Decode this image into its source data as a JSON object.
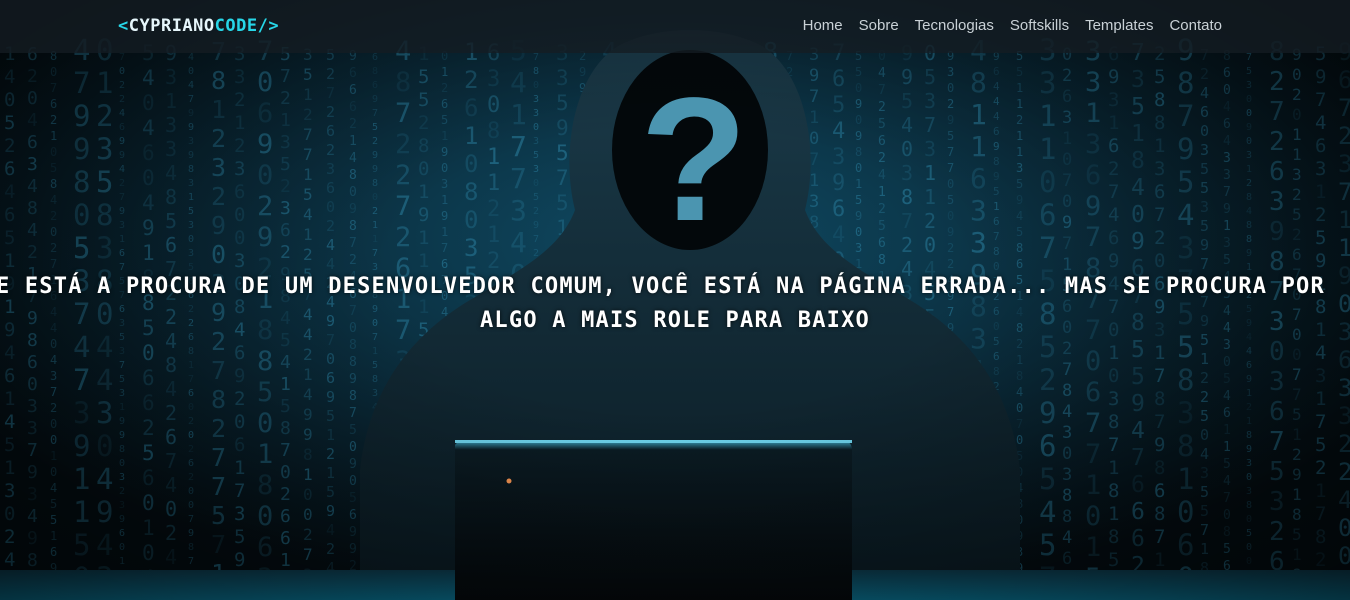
{
  "navbar": {
    "logo": {
      "open_bracket": "<",
      "part1": "CYPRIANO",
      "part2": "CODE",
      "close_bracket": "/>"
    },
    "links": [
      "Home",
      "Sobre",
      "Tecnologias",
      "Softskills",
      "Templates",
      "Contato"
    ]
  },
  "hero": {
    "question_mark": "?",
    "headline_line1": "S E ESTÁ A PROCURA DE UM DESENVOLVEDOR COMUM, VOCÊ ESTÁ NA PÁGINA ERRADA... MAS SE PROCURA POR",
    "headline_line2": "ALGO A MAIS ROLE PARA BAIXO",
    "background": "hooded-hacker-with-laptop-in-front-of-matrix-code",
    "accent_color": "#27d7e8"
  }
}
